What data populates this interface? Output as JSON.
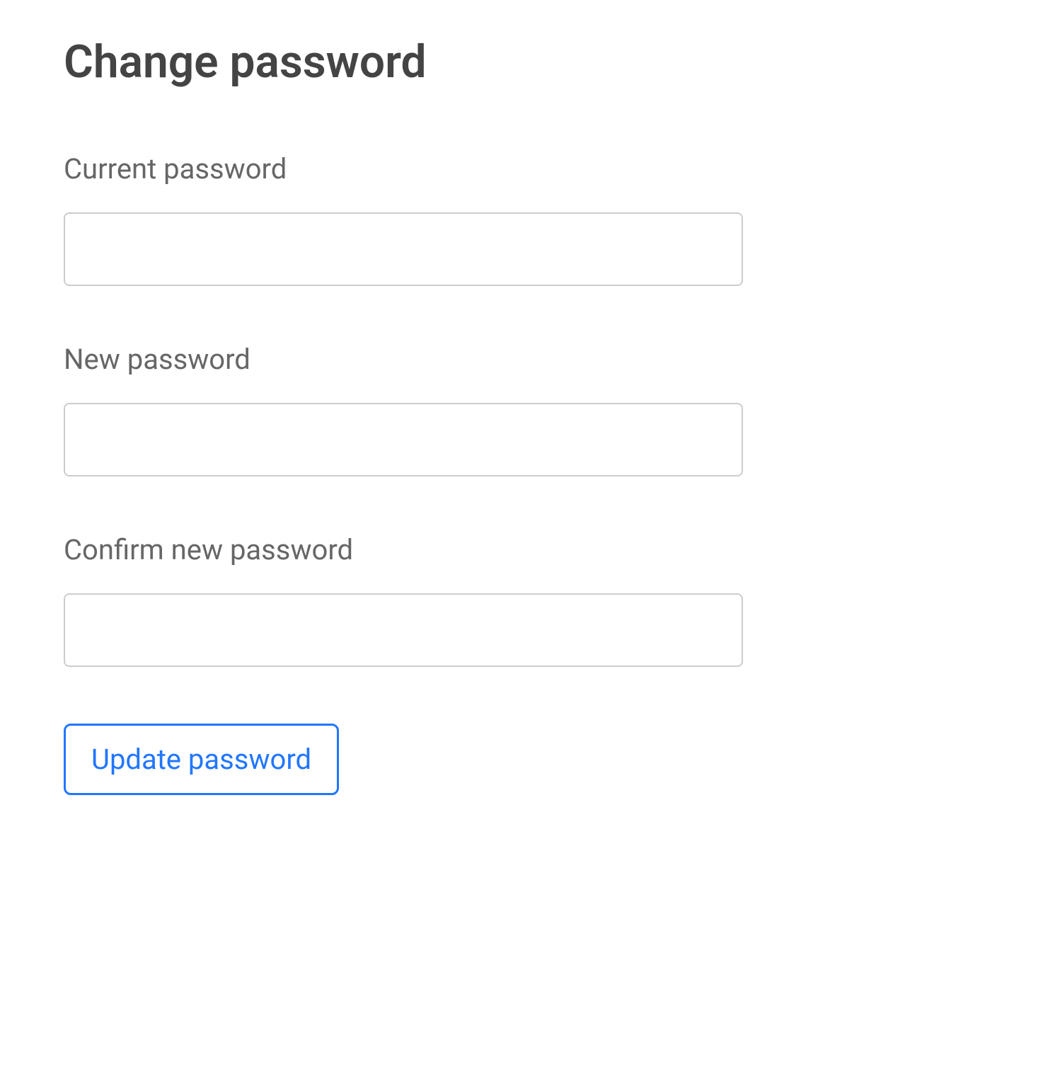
{
  "page": {
    "title": "Change password"
  },
  "form": {
    "fields": {
      "current": {
        "label": "Current password",
        "value": ""
      },
      "new": {
        "label": "New password",
        "value": ""
      },
      "confirm": {
        "label": "Confirm new password",
        "value": ""
      }
    },
    "submit_label": "Update password"
  }
}
